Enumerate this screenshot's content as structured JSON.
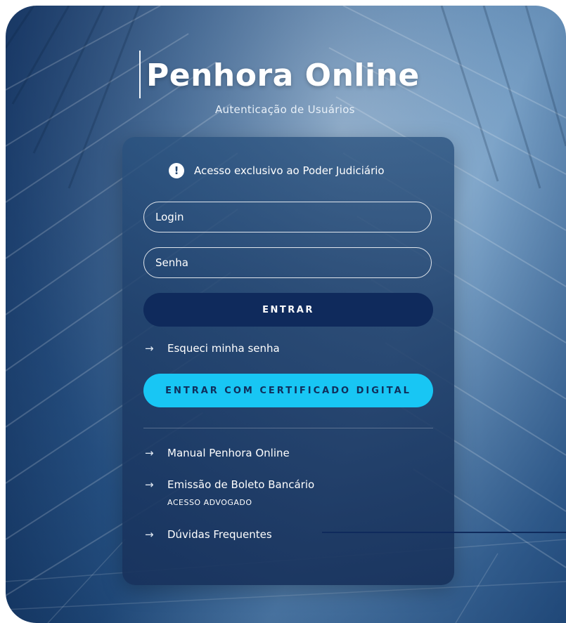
{
  "header": {
    "title": "Penhora Online",
    "subtitle": "Autenticação de Usuários"
  },
  "notice": {
    "icon": "exclamation-icon",
    "text": "Acesso exclusivo ao Poder Judiciário"
  },
  "form": {
    "login_placeholder": "Login",
    "password_placeholder": "Senha",
    "submit_label": "ENTRAR",
    "forgot_label": "Esqueci minha senha",
    "certificate_label": "ENTRAR COM CERTIFICADO DIGITAL"
  },
  "links": {
    "manual": "Manual Penhora Online",
    "boleto": "Emissão de Boleto Bancário",
    "boleto_sub": "ACESSO ADVOGADO",
    "faq": "Dúvidas Frequentes"
  },
  "icons": {
    "arrow": "→"
  },
  "colors": {
    "primary_button": "#0f2a5c",
    "certificate_button": "#18c6f4",
    "card_background": "#24466f"
  }
}
